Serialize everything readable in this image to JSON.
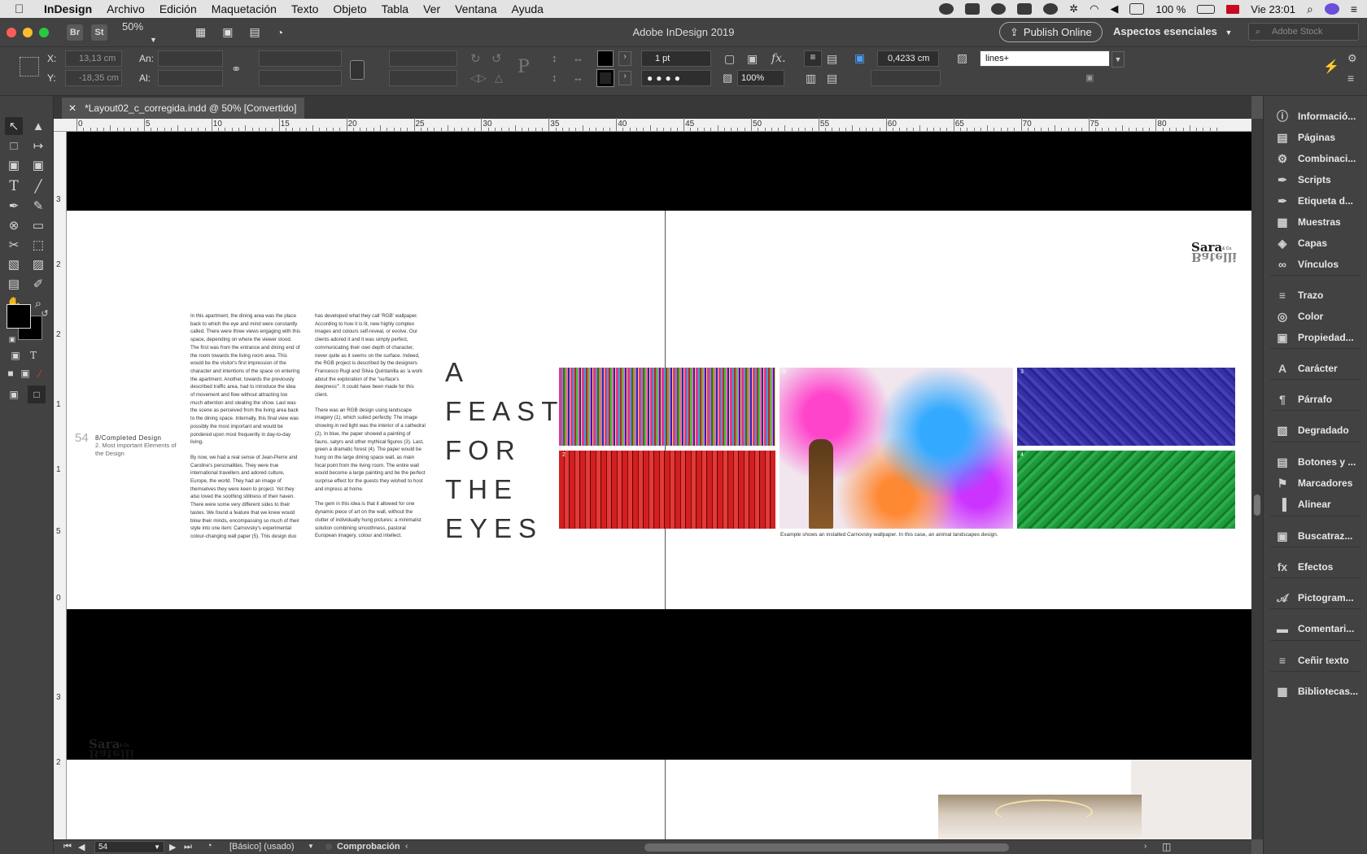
{
  "menubar": {
    "items": [
      "InDesign",
      "Archivo",
      "Edición",
      "Maquetación",
      "Texto",
      "Objeto",
      "Tabla",
      "Ver",
      "Ventana",
      "Ayuda"
    ],
    "battery": "100 %",
    "clock": "Vie 23:01"
  },
  "appbar": {
    "btn_br": "Br",
    "btn_st": "St",
    "zoom": "50%",
    "title": "Adobe InDesign 2019",
    "publish": "Publish Online",
    "workspace": "Aspectos esenciales",
    "stock_placeholder": "Adobe Stock"
  },
  "control": {
    "x_label": "X:",
    "y_label": "Y:",
    "x_value": "13,13 cm",
    "y_value": "-18,35 cm",
    "w_label": "An:",
    "h_label": "Al:",
    "stroke_weight": "1 pt",
    "opacity": "100%",
    "stroke_offset": "0,4233 cm",
    "style_field": "lines+",
    "fx_label": "fx."
  },
  "document": {
    "tab_title": "*Layout02_c_corregida.indd @ 50% [Convertido]",
    "ruler_top": [
      "0",
      "5",
      "10",
      "15",
      "20",
      "25",
      "30",
      "35",
      "40",
      "45",
      "50",
      "55",
      "60",
      "65",
      "70",
      "75",
      "80"
    ],
    "ruler_left": [
      "3",
      "2",
      "2",
      "1",
      "1",
      "5",
      "0",
      "3",
      "2"
    ]
  },
  "spread": {
    "folio_number": "54",
    "folio_section": "8/Completed Design",
    "folio_sub": "2. Most important Elements of the Design",
    "col1_p1": "In this apartment, the dining area was the place back to which the eye and mind were constantly called. There were three views engaging with this space, depending on where the viewer stood. The first was from the entrance and dining end of the room towards the living room area. This would be the visitor's first impression of the character and intentions of the space on entering the apartment. Another, towards the previously described traffic area, had to introduce the idea of movement and flow without attracting too much attention and stealing the show. Last was the scene as perceived from the living area back to the dining space. Internally, this final view was possibly the most important and would be pondered upon most frequently in day-to-day living.",
    "col1_p2": "By now, we had a real sense of Jean-Pierre and Caroline's personalities. They were true international travellers and adored culture, Europe, the world. They had an image of themselves they were keen to project. Yet they also loved the soothing stillness of their haven. There were some very different sides to their tastes. We found a feature that we knew would blow their minds, encompassing so much of their style into one item: Carnovsky's experimental colour-changing wall paper (5). This design duo",
    "col2_p1": "has developed what they call 'RGB' wallpaper. According to how it is lit, new highly complex images and colours self-reveal, or evolve. Our clients adored it and it was simply perfect, communicating their own depth of character, never quite as it seems on the surface. Indeed, the RGB project is described by the designers Francesco Rugi and Silvia Quintanilla as 'a work about the exploration of the \"surface's deepness\"'. It could have been made for this client.",
    "col2_p2": "There was an RGB design using landscape imagery (1), which suited perfectly. The image showing in red light was the interior of a cathedral (2). In blue, the paper showed a painting of fauns, satyrs and other mythical figures (3). Last, green a dramatic forest (4). The paper would be hung on the large dining space wall, as main focal point from the living room. The entire wall would become a large painting and be the perfect surprise effect for the guests they wished to host and impress at home.",
    "col2_p3": "The gem in this idea is that it allowed for one dynamic piece of art on the wall, without the clutter of individually hung pictures: a minimalist solution combining smoothness, pastoral European imagery, colour and intellect.",
    "title_lines": [
      "A",
      "FEAST",
      "FOR",
      "THE",
      "EYES"
    ],
    "logo_name": "Sara",
    "logo_co": "& Co.",
    "logo_mirror": "Batelli",
    "image_labels": [
      "2",
      "5",
      "3",
      "4"
    ],
    "caption": "Example shows an installed Carnovsky wallpaper. In this case, an animal landscapes design."
  },
  "statusbar": {
    "page": "54",
    "style": "[Básico] (usado)",
    "preflight": "Comprobación"
  },
  "right_panel": [
    {
      "icon": "info",
      "label": "Informació..."
    },
    {
      "icon": "pages",
      "label": "Páginas"
    },
    {
      "icon": "merge",
      "label": "Combinaci..."
    },
    {
      "icon": "scripts",
      "label": "Scripts"
    },
    {
      "icon": "script-label",
      "label": "Etiqueta d..."
    },
    {
      "icon": "swatches",
      "label": "Muestras"
    },
    {
      "icon": "layers",
      "label": "Capas"
    },
    {
      "icon": "links",
      "label": "Vínculos"
    },
    {
      "icon": "stroke",
      "label": "Trazo"
    },
    {
      "icon": "color",
      "label": "Color"
    },
    {
      "icon": "properties",
      "label": "Propiedad..."
    },
    {
      "icon": "character",
      "label": "Carácter"
    },
    {
      "icon": "paragraph",
      "label": "Párrafo"
    },
    {
      "icon": "gradient",
      "label": "Degradado"
    },
    {
      "icon": "buttons",
      "label": "Botones y ..."
    },
    {
      "icon": "bookmarks",
      "label": "Marcadores"
    },
    {
      "icon": "align",
      "label": "Alinear"
    },
    {
      "icon": "pathfinder",
      "label": "Buscatraz..."
    },
    {
      "icon": "effects",
      "label": "Efectos"
    },
    {
      "icon": "glyphs",
      "label": "Pictogram..."
    },
    {
      "icon": "comments",
      "label": "Comentari..."
    },
    {
      "icon": "text-wrap",
      "label": "Ceñir texto"
    },
    {
      "icon": "libraries",
      "label": "Bibliotecas..."
    }
  ],
  "colors": {
    "ui_dark": "#424242",
    "canvas": "#000000",
    "page": "#ffffff",
    "img_red": "#d21f1f",
    "img_blue": "#3530a6",
    "img_green": "#1e9a3c"
  }
}
